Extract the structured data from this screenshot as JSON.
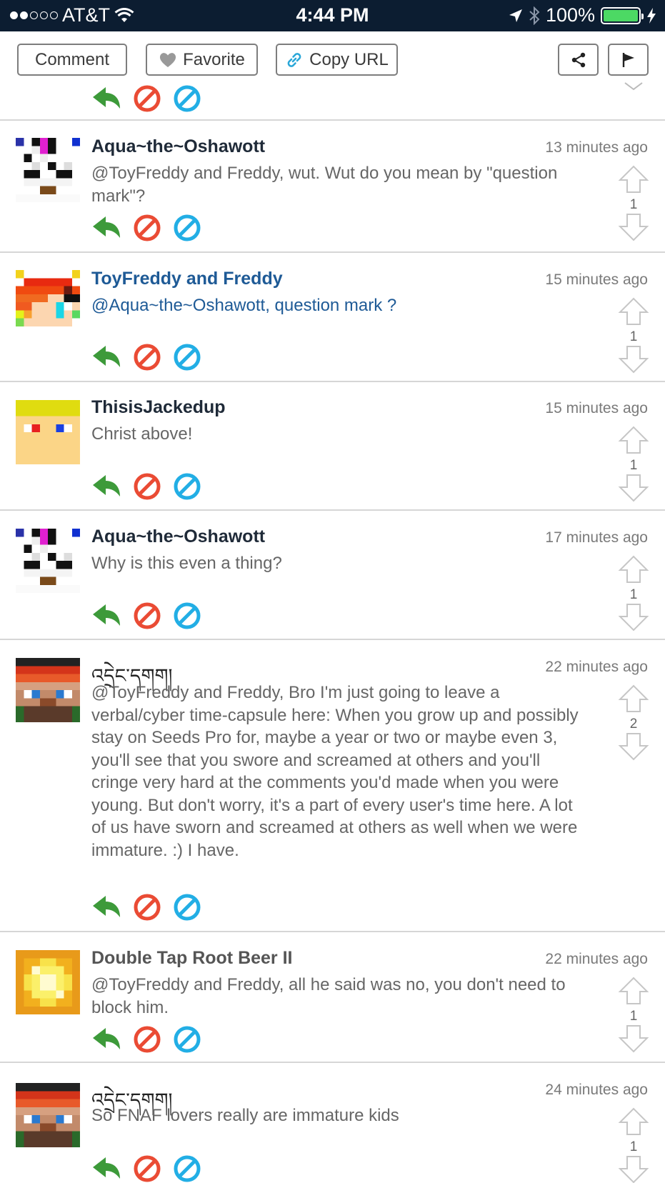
{
  "status_bar": {
    "carrier": "AT&T",
    "time": "4:44 PM",
    "battery": "100%"
  },
  "toolbar": {
    "comment_label": "Comment",
    "favorite_label": "Favorite",
    "copy_url_label": "Copy URL"
  },
  "colors": {
    "reply": "#3d9a3a",
    "block": "#ea4b34",
    "report": "#22aee5",
    "status_bar_bg": "#0c1d31"
  },
  "comments": [
    {
      "author": "Aqua~the~Oshawott",
      "time": "13 minutes ago",
      "text": "@ToyFreddy and Freddy, wut. Wut do you mean by \"question mark\"?",
      "votes": "1"
    },
    {
      "author": "ToyFreddy and Freddy",
      "time": "15 minutes ago",
      "text": "@Aqua~the~Oshawott, question mark ?",
      "votes": "1"
    },
    {
      "author": "ThisisJackedup",
      "time": "15 minutes ago",
      "text": "Christ above!",
      "votes": "1"
    },
    {
      "author": "Aqua~the~Oshawott",
      "time": "17 minutes ago",
      "text": "Why is this even a thing?",
      "votes": "1"
    },
    {
      "author": "འདྲེང་དགག།",
      "time": "22 minutes ago",
      "text": "@ToyFreddy and Freddy, Bro I'm just going to leave a verbal/cyber time-capsule here: When you grow up and possibly stay on Seeds Pro for, maybe a year or two or maybe even 3, you'll see that you swore and screamed at others and you'll cringe very hard at the comments you'd made when you were young. But don't worry, it's a part of every user's time here. A lot of us have sworn and screamed at others as well when we were immature. :) I have.",
      "votes": "2"
    },
    {
      "author": "Double Tap Root Beer II",
      "time": "22 minutes ago",
      "text": "@ToyFreddy and Freddy, all he said was no, you don't need to block him.",
      "votes": "1"
    },
    {
      "author": "འདྲེང་དགག།",
      "time": "24 minutes ago",
      "text": "So FNAF lovers really are immature kids",
      "votes": "1"
    }
  ]
}
